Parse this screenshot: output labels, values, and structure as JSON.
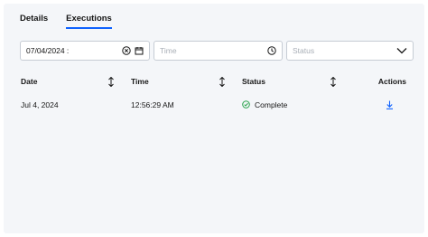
{
  "tabs": [
    {
      "label": "Details",
      "active": false
    },
    {
      "label": "Executions",
      "active": true
    }
  ],
  "filters": {
    "date_value": "07/04/2024 :",
    "time_placeholder": "Time",
    "status_placeholder": "Status"
  },
  "table": {
    "columns": [
      "Date",
      "Time",
      "Status",
      "Actions"
    ],
    "rows": [
      {
        "date": "Jul 4, 2024",
        "time": "12:56:29 AM",
        "status": "Complete"
      }
    ]
  },
  "colors": {
    "accent": "#0f62fe",
    "success": "#24a148",
    "panel": "#f4f6f9"
  }
}
